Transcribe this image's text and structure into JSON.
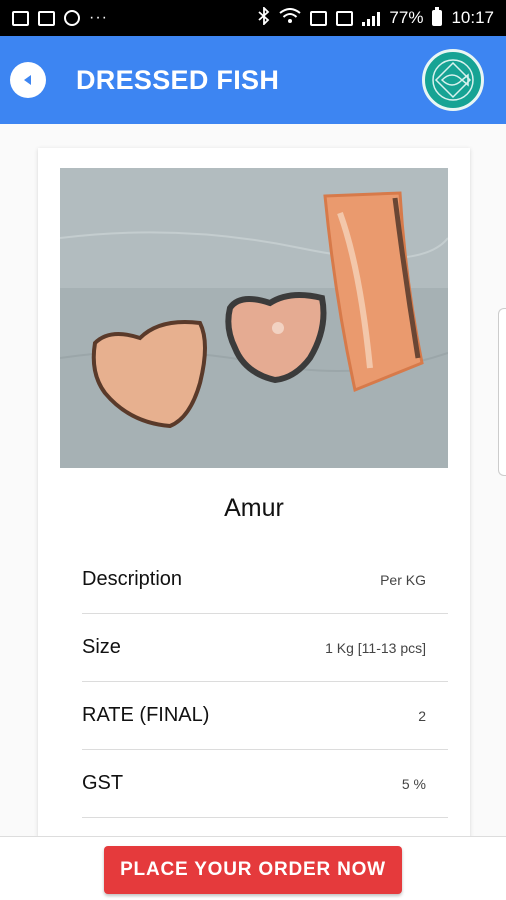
{
  "status_bar": {
    "battery": "77%",
    "time": "10:17",
    "overflow": "···"
  },
  "app_bar": {
    "title": "DRESSED FISH",
    "logo_icon": "fish-logo-icon",
    "color": "#3d85f2"
  },
  "product": {
    "name": "Amur",
    "image_icon": "fish-pieces-photo",
    "details": [
      {
        "label": "Description",
        "value": "Per KG"
      },
      {
        "label": "Size",
        "value": "1 Kg [11-13 pcs]"
      },
      {
        "label": "RATE (FINAL)",
        "value": "2"
      },
      {
        "label": "GST",
        "value": "5 %"
      }
    ]
  },
  "order_button": {
    "label": "PLACE YOUR ORDER NOW",
    "color": "#e53a3c"
  }
}
